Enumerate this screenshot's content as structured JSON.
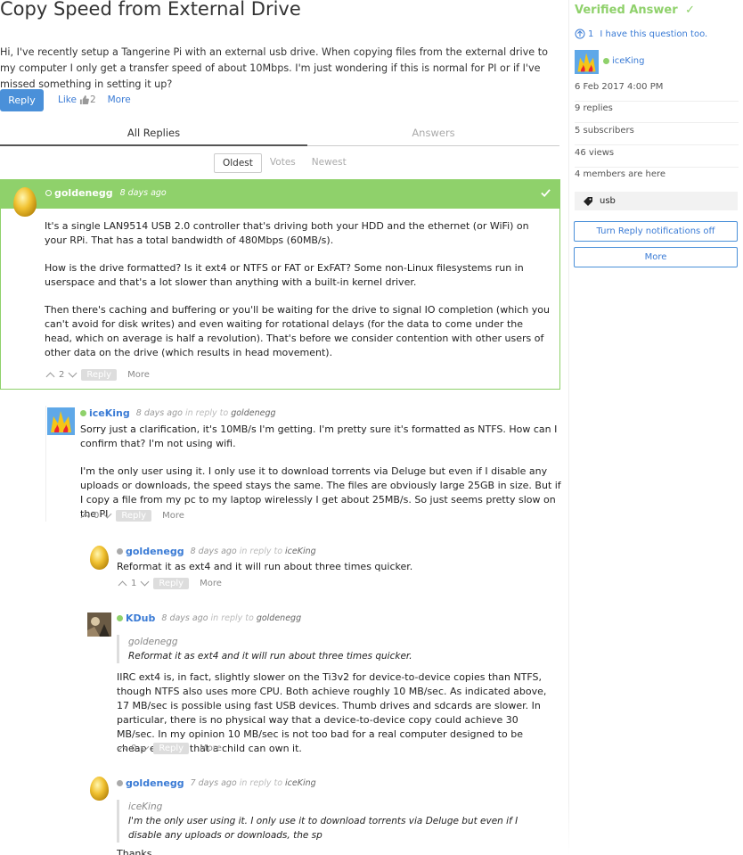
{
  "question": {
    "title": "Copy Speed from External Drive",
    "body": "Hi, I've recently setup a Tangerine Pi with an external usb drive. When copying files from the external drive to my computer I only get a transfer speed of about 10Mbps. I'm just wondering if this is normal for PI or if I've missed something in setting it up?",
    "reply_label": "Reply",
    "like_label": "Like",
    "like_count": "2",
    "more_label": "More"
  },
  "tabs": [
    "All Replies",
    "Answers"
  ],
  "sort": [
    "Oldest",
    "Votes",
    "Newest"
  ],
  "accepted": {
    "user": "goldenegg",
    "time": "8 days ago",
    "p1": "It's a single LAN9514 USB 2.0 controller that's driving both your HDD and the ethernet (or WiFi) on your RPi. That has a total bandwidth of 480Mbps (60MB/s).",
    "p2": "How is the drive formatted? Is it ext4 or NTFS or FAT or ExFAT? Some non-Linux filesystems run in userspace and that's a lot slower than anything with a built-in kernel driver.",
    "p3": "Then there's caching and buffering or you'll be waiting for the drive to signal IO completion (which you can't avoid for disk writes) and even waiting for rotational delays (for the data to come under the head, which on average is half a revolution). That's before we consider contention with other users of other data on the drive (which results in head movement).",
    "votes": "2",
    "reply_label": "Reply",
    "more_label": "More"
  },
  "reply1": {
    "user": "iceKing",
    "time": "8 days ago",
    "in_reply_to": "in reply to",
    "target": "goldenegg",
    "p1": "Sorry just a clarification, it's 10MB/s I'm getting. I'm pretty sure it's formatted as NTFS. How can I confirm that? I'm not using wifi.",
    "p2": "I'm the only user using it. I only use it to download torrents via Deluge but even if I disable any uploads or downloads, the speed stays the same. The files are obviously large 25GB in size. But if I copy a file from my pc to my laptop wirelessly I get about 25MB/s. So just seems pretty slow on the PI",
    "votes": "0",
    "reply_label": "Reply",
    "more_label": "More"
  },
  "reply2": {
    "user": "goldenegg",
    "time": "8 days ago",
    "in_reply_to": "in reply to",
    "target": "iceKing",
    "p1": "Reformat it as ext4 and it will run about three times quicker.",
    "votes": "1",
    "reply_label": "Reply",
    "more_label": "More"
  },
  "reply3": {
    "user": "KDub",
    "time": "8 days ago",
    "in_reply_to": "in reply to",
    "target": "goldenegg",
    "quote_name": "goldenegg",
    "quote_text": "Reformat it as ext4 and it will run about three times quicker.",
    "p1": "IIRC ext4 is, in fact, slightly slower on the Ti3v2 for device-to-device copies than NTFS, though NTFS also uses more CPU. Both achieve roughly 10 MB/sec. As indicated above, 17 MB/sec is possible using fast USB devices. Thumb drives and sdcards are slower. In particular, there is no physical way that a device-to-device copy could achieve 30 MB/sec. In my opinion 10 MB/sec is not too bad for a real computer designed to be cheap enough that a child can own it.",
    "votes": "0",
    "reply_label": "Reply",
    "more_label": "More"
  },
  "reply4": {
    "user": "goldenegg",
    "time": "7 days ago",
    "in_reply_to": "in reply to",
    "target": "iceKing",
    "quote_name": "iceKing",
    "quote_text": "I'm the only user using it. I only use it to download torrents via Deluge but even if I disable any uploads or downloads, the sp",
    "p1": "Thanks"
  },
  "sidebar": {
    "verified": "Verified Answer",
    "same_count": "1",
    "same_label": "I have this question too.",
    "asker": "iceKing",
    "date": "6 Feb 2017 4:00 PM",
    "replies": "9 replies",
    "subscribers": "5 subscribers",
    "views": "46 views",
    "members": "4 members are here",
    "tag": "usb",
    "notif_btn": "Turn Reply notifications off",
    "more_btn": "More"
  },
  "colors": {
    "accent": "#4a90d9",
    "verified": "#8fd16b",
    "online": "#8fd16b"
  }
}
